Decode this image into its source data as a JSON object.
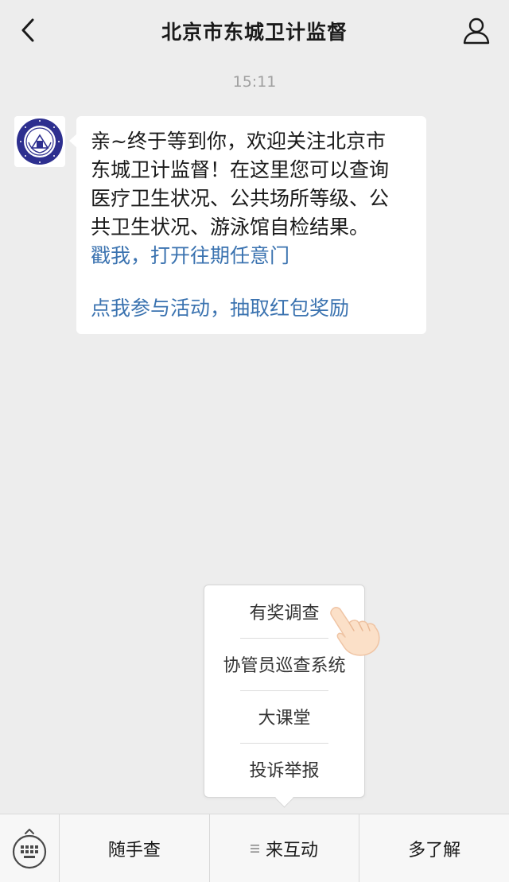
{
  "header": {
    "title": "北京市东城卫计监督",
    "back_icon": "chevron-left-icon",
    "profile_icon": "user-icon"
  },
  "chat": {
    "timestamp": "15:11",
    "message": {
      "line1": "亲~终于等到你，欢迎关注北京市",
      "line2": "东城卫计监督！在这里您可以查询",
      "line3": "医疗卫生状况、公共场所等级、公",
      "line4": "共卫生状况、游泳馆自检结果。",
      "link1": "戳我，打开往期任意门",
      "link2": "点我参与活动，抽取红包奖励"
    }
  },
  "popup_menu": {
    "items": [
      {
        "label": "有奖调查"
      },
      {
        "label": "协管员巡查系统"
      },
      {
        "label": "大课堂"
      },
      {
        "label": "投诉举报"
      }
    ]
  },
  "bottom_menu": {
    "keyboard_icon": "keyboard-icon",
    "tabs": [
      {
        "label": "随手查"
      },
      {
        "label": "来互动"
      },
      {
        "label": "多了解"
      }
    ]
  },
  "colors": {
    "background": "#ededed",
    "link": "#3b73b0",
    "bubble": "#ffffff",
    "avatar_logo": "#2d2f8f"
  }
}
